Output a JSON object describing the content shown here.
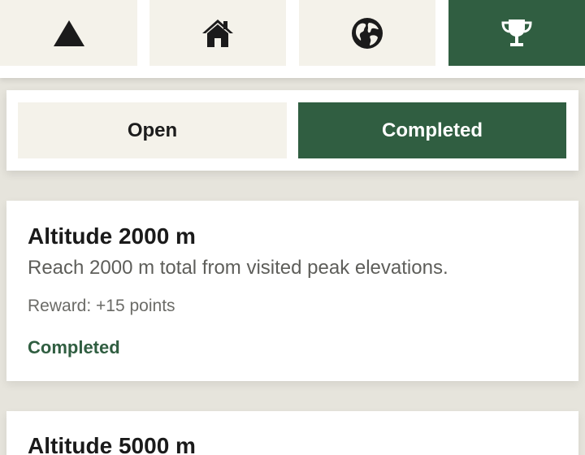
{
  "nav": {
    "tabs": [
      {
        "icon": "mountain-icon",
        "active": false
      },
      {
        "icon": "home-icon",
        "active": false
      },
      {
        "icon": "globe-icon",
        "active": false
      },
      {
        "icon": "trophy-icon",
        "active": true
      }
    ]
  },
  "segment": {
    "open_label": "Open",
    "completed_label": "Completed",
    "selected": "completed"
  },
  "challenges": [
    {
      "title": "Altitude 2000 m",
      "description": "Reach 2000 m total from visited peak elevations.",
      "reward": "Reward: +15 points",
      "status": "Completed"
    },
    {
      "title": "Altitude 5000 m"
    }
  ],
  "colors": {
    "accent": "#305e41",
    "tab_bg": "#f4f2ea",
    "page_bg": "#e6e4dc",
    "card_bg": "#ffffff"
  }
}
